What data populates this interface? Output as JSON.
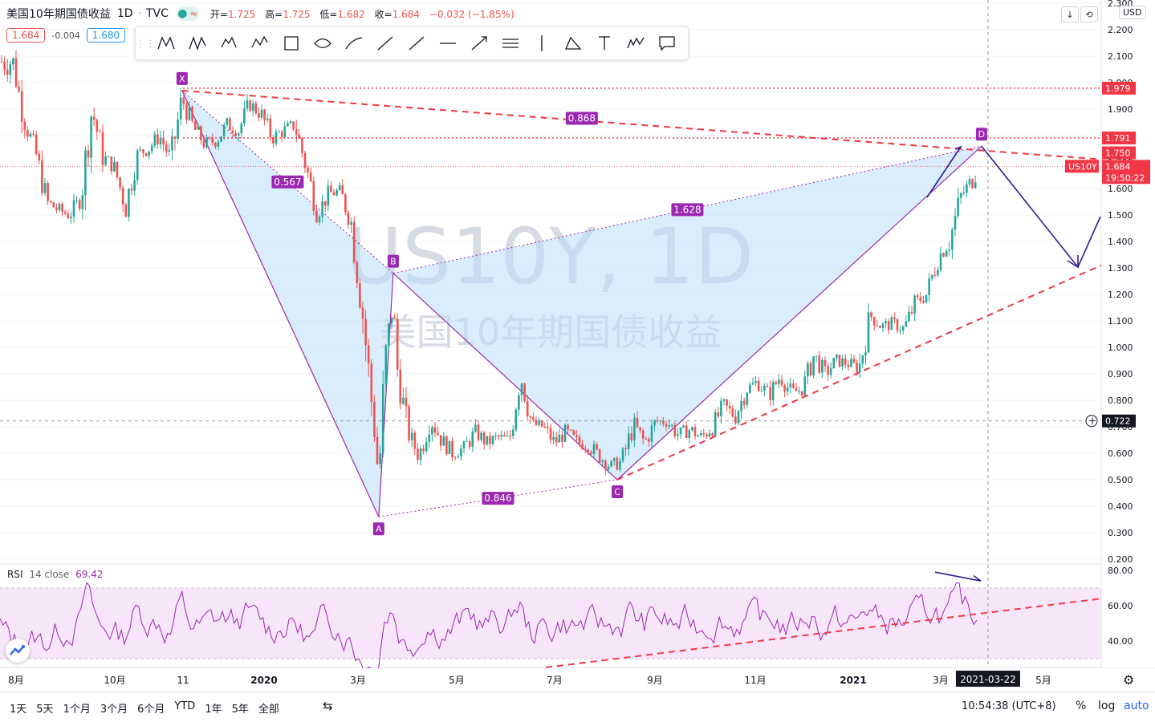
{
  "header": {
    "symbol_title": "美国10年期国债收益",
    "interval": "1D",
    "exchange": "TVC",
    "open_label": "开=",
    "open": "1.725",
    "high_label": "高=",
    "high": "1.725",
    "low_label": "低=",
    "low": "1.682",
    "close_label": "收=",
    "close": "1.684",
    "change": "−0.032 (−1.85%)"
  },
  "pills": {
    "sell": "1.684",
    "spread": "-0.004",
    "buy": "1.680"
  },
  "toolbar": {
    "tools": [
      "xabcd-pattern-icon",
      "cypher-pattern-icon",
      "head-shoulders-icon",
      "abcd-pattern-icon",
      "rectangle-icon",
      "ellipse-icon",
      "path-icon",
      "trend-line-icon",
      "ray-icon",
      "horizontal-line-icon",
      "arrow-line-icon",
      "parallel-channel-icon",
      "vertical-line-icon",
      "fib-retracement-icon",
      "text-icon",
      "elliott-wave-icon",
      "callout-icon"
    ]
  },
  "right_controls": {
    "currency": "USD"
  },
  "watermark": {
    "line1": "US10Y, 1D",
    "line2": "美国10年期国债收益"
  },
  "pattern": {
    "points": [
      {
        "label": "X",
        "date": "2019-11-08",
        "value": 1.97
      },
      {
        "label": "A",
        "date": "2020-03-09",
        "value": 0.36
      },
      {
        "label": "B",
        "date": "2020-03-18",
        "value": 1.28
      },
      {
        "label": "C",
        "date": "2020-08-04",
        "value": 0.5
      },
      {
        "label": "D",
        "date": "2021-03-18",
        "value": 1.76
      }
    ],
    "ratios": [
      {
        "text": "0.567",
        "from": "X",
        "to": "B"
      },
      {
        "text": "0.868",
        "from": "X",
        "to": "D"
      },
      {
        "text": "1.628",
        "from": "B",
        "to": "D"
      },
      {
        "text": "0.846",
        "from": "A",
        "to": "C"
      }
    ]
  },
  "price_axis": {
    "ticks": [
      "2.300",
      "2.200",
      "2.100",
      "2.000",
      "1.900",
      "1.800",
      "1.700",
      "1.600",
      "1.500",
      "1.400",
      "1.300",
      "1.200",
      "1.100",
      "1.000",
      "0.900",
      "0.800",
      "0.700",
      "0.600",
      "0.500",
      "0.400",
      "0.300",
      "0.200"
    ],
    "labels": [
      {
        "text": "1.979",
        "value": 1.979,
        "color": "#f23645"
      },
      {
        "text": "1.791",
        "value": 1.791,
        "color": "#f23645"
      },
      {
        "text": "1.750",
        "value": 1.75,
        "color": "#f23645"
      },
      {
        "text": "US10Y",
        "value": 1.684,
        "color": "#f23645"
      },
      {
        "text": "1.684",
        "value": 1.684,
        "color": "#f23645"
      },
      {
        "text": "19:50:22",
        "value": 1.684,
        "color": "#f23645"
      },
      {
        "text": "0.722",
        "value": 0.722,
        "color": "#131722"
      }
    ]
  },
  "rsi": {
    "label": "RSI",
    "params": "14 close",
    "value": "69.42",
    "ticks": [
      "80.00",
      "60.00",
      "40.00"
    ],
    "upper_band": 70,
    "lower_band": 30
  },
  "time_axis": {
    "ticks": [
      "8月",
      "10月",
      "11",
      "2020",
      "3月",
      "5月",
      "7月",
      "9月",
      "11月",
      "2021",
      "3月",
      "5月"
    ],
    "crosshair_date": "2021-03-22"
  },
  "bottom_bar": {
    "periods": [
      "1天",
      "5天",
      "1个月",
      "3个月",
      "6个月",
      "YTD",
      "1年",
      "5年",
      "全部"
    ],
    "clock": "10:54:38 (UTC+8)",
    "percent": "%",
    "log": "log",
    "auto": "auto"
  },
  "colors": {
    "up": "#26a69a",
    "down": "#ef5350",
    "pattern": "#9c27b0",
    "pattern_fill": "#bbdefb",
    "dash_red": "#f23645",
    "arrows": "#311b92"
  },
  "chart_data": {
    "type": "candlestick",
    "ylim": [
      0.2,
      2.3
    ],
    "close_series": [
      [
        "2019-07-26",
        2.08
      ],
      [
        "2019-08-02",
        1.86
      ],
      [
        "2019-08-09",
        1.74
      ],
      [
        "2019-08-16",
        1.55
      ],
      [
        "2019-08-23",
        1.52
      ],
      [
        "2019-08-30",
        1.5
      ],
      [
        "2019-09-06",
        1.56
      ],
      [
        "2019-09-13",
        1.9
      ],
      [
        "2019-09-20",
        1.72
      ],
      [
        "2019-09-27",
        1.68
      ],
      [
        "2019-10-04",
        1.53
      ],
      [
        "2019-10-11",
        1.73
      ],
      [
        "2019-10-18",
        1.75
      ],
      [
        "2019-10-25",
        1.8
      ],
      [
        "2019-11-01",
        1.71
      ],
      [
        "2019-11-08",
        1.94
      ],
      [
        "2019-11-15",
        1.83
      ],
      [
        "2019-11-22",
        1.77
      ],
      [
        "2019-11-29",
        1.78
      ],
      [
        "2019-12-06",
        1.84
      ],
      [
        "2019-12-13",
        1.82
      ],
      [
        "2019-12-20",
        1.92
      ],
      [
        "2019-12-27",
        1.88
      ],
      [
        "2020-01-03",
        1.79
      ],
      [
        "2020-01-10",
        1.82
      ],
      [
        "2020-01-17",
        1.84
      ],
      [
        "2020-01-24",
        1.68
      ],
      [
        "2020-01-31",
        1.51
      ],
      [
        "2020-02-07",
        1.58
      ],
      [
        "2020-02-14",
        1.59
      ],
      [
        "2020-02-21",
        1.47
      ],
      [
        "2020-02-28",
        1.13
      ],
      [
        "2020-03-06",
        0.71
      ],
      [
        "2020-03-09",
        0.5
      ],
      [
        "2020-03-13",
        0.96
      ],
      [
        "2020-03-18",
        1.18
      ],
      [
        "2020-03-20",
        0.94
      ],
      [
        "2020-03-27",
        0.68
      ],
      [
        "2020-04-03",
        0.59
      ],
      [
        "2020-04-10",
        0.73
      ],
      [
        "2020-04-17",
        0.65
      ],
      [
        "2020-04-24",
        0.6
      ],
      [
        "2020-05-01",
        0.62
      ],
      [
        "2020-05-08",
        0.68
      ],
      [
        "2020-05-15",
        0.64
      ],
      [
        "2020-05-22",
        0.66
      ],
      [
        "2020-05-29",
        0.65
      ],
      [
        "2020-06-05",
        0.9
      ],
      [
        "2020-06-12",
        0.71
      ],
      [
        "2020-06-19",
        0.7
      ],
      [
        "2020-06-26",
        0.64
      ],
      [
        "2020-07-03",
        0.68
      ],
      [
        "2020-07-10",
        0.64
      ],
      [
        "2020-07-17",
        0.63
      ],
      [
        "2020-07-24",
        0.59
      ],
      [
        "2020-07-31",
        0.55
      ],
      [
        "2020-08-07",
        0.57
      ],
      [
        "2020-08-14",
        0.71
      ],
      [
        "2020-08-21",
        0.64
      ],
      [
        "2020-08-28",
        0.72
      ],
      [
        "2020-09-04",
        0.72
      ],
      [
        "2020-09-11",
        0.67
      ],
      [
        "2020-09-18",
        0.69
      ],
      [
        "2020-09-25",
        0.66
      ],
      [
        "2020-10-02",
        0.7
      ],
      [
        "2020-10-09",
        0.78
      ],
      [
        "2020-10-16",
        0.74
      ],
      [
        "2020-10-23",
        0.84
      ],
      [
        "2020-10-30",
        0.87
      ],
      [
        "2020-11-06",
        0.82
      ],
      [
        "2020-11-13",
        0.89
      ],
      [
        "2020-11-20",
        0.83
      ],
      [
        "2020-11-27",
        0.84
      ],
      [
        "2020-12-04",
        0.97
      ],
      [
        "2020-12-11",
        0.9
      ],
      [
        "2020-12-18",
        0.95
      ],
      [
        "2020-12-25",
        0.94
      ],
      [
        "2021-01-01",
        0.92
      ],
      [
        "2021-01-08",
        1.12
      ],
      [
        "2021-01-15",
        1.08
      ],
      [
        "2021-01-22",
        1.09
      ],
      [
        "2021-01-29",
        1.07
      ],
      [
        "2021-02-05",
        1.17
      ],
      [
        "2021-02-12",
        1.2
      ],
      [
        "2021-02-19",
        1.34
      ],
      [
        "2021-02-26",
        1.4
      ],
      [
        "2021-03-05",
        1.57
      ],
      [
        "2021-03-12",
        1.63
      ],
      [
        "2021-03-19",
        1.72
      ],
      [
        "2021-03-22",
        1.684
      ]
    ]
  }
}
